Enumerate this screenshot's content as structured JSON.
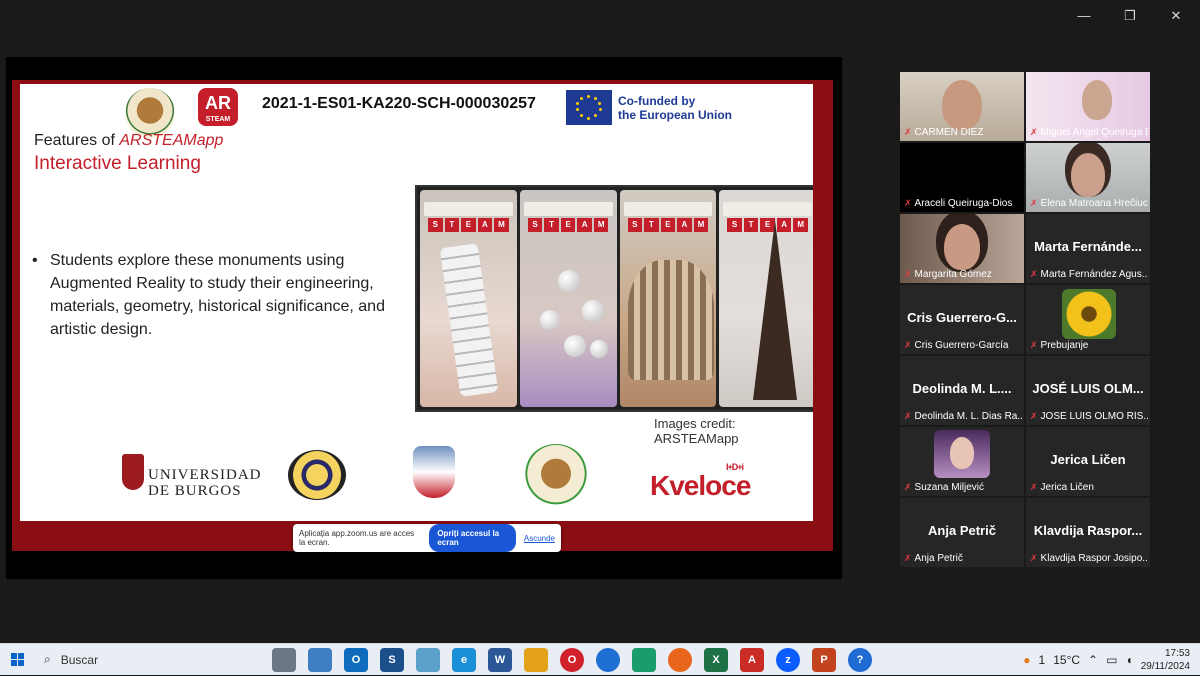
{
  "window": {
    "controls": [
      "—",
      "❐",
      "✕"
    ]
  },
  "slide": {
    "project_code": "2021-1-ES01-KA220-SCH-000030257",
    "eu_text_line1": "Co-funded by",
    "eu_text_line2": "the European Union",
    "ar_logo": "AR",
    "ar_logo_sub": "STEAM",
    "features_prefix": "Features of ",
    "features_app": "ARSTEAMapp",
    "subtitle": "Interactive Learning",
    "bullet": "Students explore these monuments using Augmented Reality to study their engineering, materials, geometry, historical significance, and artistic design.",
    "credit": "Images credit: ARSTEAMapp",
    "phone_letters": [
      "S",
      "T",
      "E",
      "A",
      "M"
    ],
    "ubu_line1": "UNIVERSIDAD",
    "ubu_line2": "DE BURGOS",
    "kveloce": "Kveloce",
    "kveloce_sup": "I+D+i"
  },
  "zoom_share_bar": {
    "message": "Aplicația app.zoom.us are acces la ecran.",
    "stop_label": "Opriți accesul la ecran",
    "hide_label": "Ascunde"
  },
  "participants": [
    {
      "name": "CARMEN DIEZ",
      "video": true
    },
    {
      "name": "Miguel Ángel Queiruga Di...",
      "video": true
    },
    {
      "name": "Araceli Queiruga-Dios",
      "video": false
    },
    {
      "name": "Elena Matroana Hrečiuc",
      "video": true,
      "active": true
    },
    {
      "name": "Margarita Gómez",
      "video": true
    },
    {
      "name": "Marta Fernández Agus...",
      "big": "Marta Fernánde...",
      "video": false
    },
    {
      "name": "Cris Guerrero-García",
      "big": "Cris Guerrero-G...",
      "video": false
    },
    {
      "name": "Prebujanje",
      "video": true
    },
    {
      "name": "Deolinda M. L. Dias Ra...",
      "big": "Deolinda M. L....",
      "video": false
    },
    {
      "name": "JOSÉ LUIS OLMO RÍS...",
      "big": "JOSÉ LUIS OLM...",
      "video": false
    },
    {
      "name": "Suzana Miljević",
      "video": true
    },
    {
      "name": "Jerica Ličen",
      "big": "Jerica Ličen",
      "video": false
    },
    {
      "name": "Anja Petrič",
      "big": "Anja Petrič",
      "video": false
    },
    {
      "name": "Klavdija Raspor Josipo...",
      "big": "Klavdija Raspor...",
      "video": false
    }
  ],
  "taskbar": {
    "search_placeholder": "Buscar",
    "weather": "15°C",
    "notification_count": "1",
    "time": "17:53",
    "date": "29/11/2024"
  }
}
